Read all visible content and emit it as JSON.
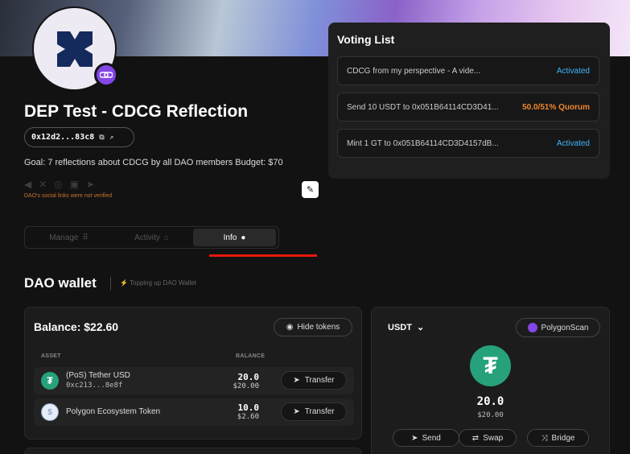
{
  "dao": {
    "title": "DEP Test - CDCG Reflection",
    "address": "0x12d2...83c8",
    "goal": "Goal: 7 reflections about CDCG by all DAO members Budget: $70",
    "social_warning": "DAO's social links were not verified",
    "icons": [
      "megaphone-icon",
      "x-icon",
      "website-icon",
      "discord-icon",
      "telegram-icon"
    ]
  },
  "tabs": [
    {
      "label": "Manage",
      "icon": "group-icon"
    },
    {
      "label": "Activity",
      "icon": "home-icon"
    },
    {
      "label": "Info",
      "icon": "info-icon"
    }
  ],
  "active_tab": "Info",
  "wallet": {
    "title": "DAO wallet",
    "subtitle": "Topping up DAO Wallet"
  },
  "voting": {
    "title": "Voting List",
    "items": [
      {
        "text": "CDCG from my perspective - A vide...",
        "status": "Activated",
        "color": "#3fb6ff"
      },
      {
        "text": "Send 10 USDT to 0x051B64114CD3D41...",
        "status": "50.0/51%  Quorum",
        "color": "#f0862e"
      },
      {
        "text": "Mint 1 GT to 0x051B64114CD3D4157dB...",
        "status": "Activated",
        "color": "#3fb6ff"
      }
    ]
  },
  "balance": {
    "title": "Balance: $22.60",
    "hide_label": "Hide tokens",
    "col_asset": "ASSET",
    "col_balance": "BALANCE",
    "transfer_label": "Transfer",
    "tokens": [
      {
        "name": "(PoS) Tether USD",
        "address": "0xc213...8e8f",
        "amount": "20.0",
        "usd": "$20.00",
        "icon": "tether-icon"
      },
      {
        "name": "Polygon Ecosystem Token",
        "address": "",
        "amount": "10.0",
        "usd": "$2.60",
        "icon": "polygon-icon"
      }
    ]
  },
  "token_panel": {
    "selected": "USDT",
    "scan_label": "PolygonScan",
    "amount": "20.0",
    "usd": "$20.00",
    "actions": [
      "Send",
      "Swap",
      "Bridge"
    ]
  },
  "colors": {
    "accent_red": "#e8180c",
    "tether_green": "#26a17b",
    "polygon_purple": "#8247e5"
  }
}
